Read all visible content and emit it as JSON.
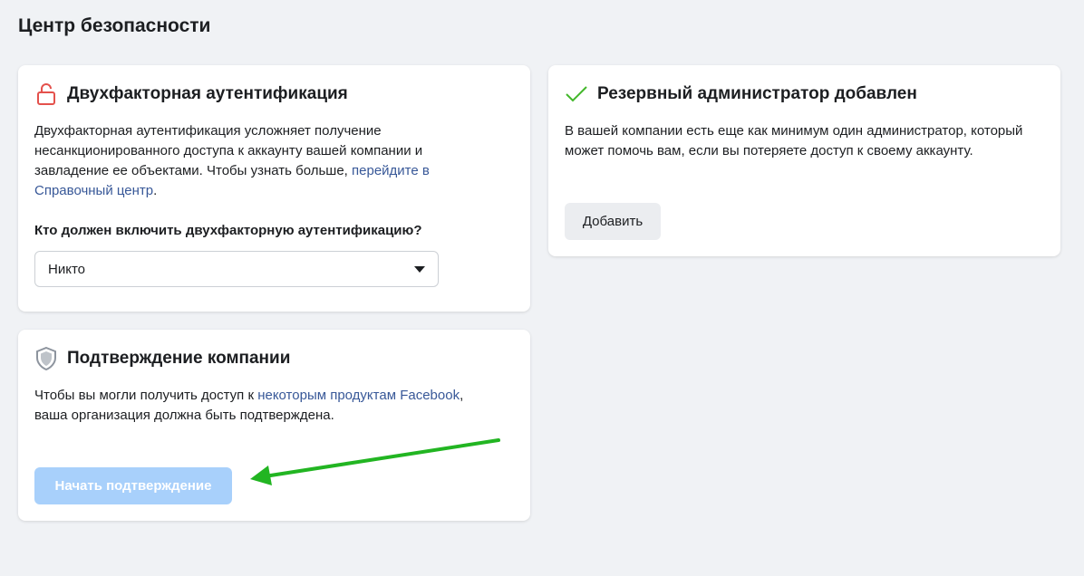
{
  "page": {
    "title": "Центр безопасности"
  },
  "two_factor": {
    "title": "Двухфакторная аутентификация",
    "icon": "unlocked-padlock-icon",
    "text_1": "Двухфакторная аутентификация усложняет получение несанкционированного доступа к аккаунту вашей компании и завладение ее объектами. Чтобы узнать больше, ",
    "link": "перейдите в Справочный центр",
    "text_2": ".",
    "question": "Кто должен включить двухфакторную аутентификацию?",
    "select_value": "Никто",
    "accent_color": "#e4514c"
  },
  "admin": {
    "title": "Резервный администратор добавлен",
    "icon": "checkmark-icon",
    "text": "В вашей компании есть еще как минимум один администратор, который может помочь вам, если вы потеряете доступ к своему аккаунту.",
    "button": "Добавить",
    "accent_color": "#42b72a"
  },
  "verification": {
    "title": "Подтверждение компании",
    "icon": "shield-icon",
    "text_1": "Чтобы вы могли получить доступ к ",
    "link": "некоторым продуктам Facebook",
    "text_2": ", ваша организация должна быть подтверждена.",
    "button": "Начать подтверждение",
    "button_color": "#a8d0fb"
  },
  "annotation": {
    "icon": "green-arrow-icon",
    "color": "#22b522"
  }
}
